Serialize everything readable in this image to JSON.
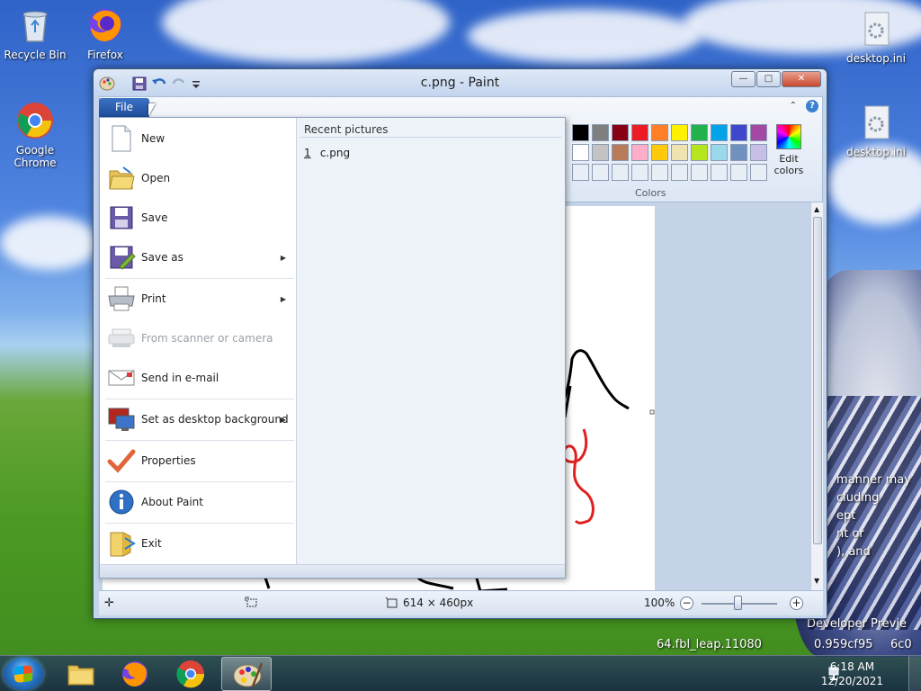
{
  "desktop": {
    "icons": [
      {
        "label": "Recycle Bin",
        "icon": "recycle-bin-icon"
      },
      {
        "label": "Firefox",
        "icon": "firefox-icon"
      },
      {
        "label": "Google Chrome",
        "icon": "chrome-icon"
      },
      {
        "label": "desktop.ini",
        "icon": "settings-file-icon"
      },
      {
        "label": "desktop.ini",
        "icon": "settings-file-icon"
      }
    ],
    "watermark_lines": [
      "manner may",
      "cluding",
      "ept",
      "nt or",
      "), and",
      "Developer Previe",
      "64.fbl_leap.11080",
      "0.959cf95",
      "6c0"
    ]
  },
  "window": {
    "title": "c.png - Paint",
    "controls": {
      "minimize": "—",
      "maximize": "□",
      "close": "✕"
    }
  },
  "ribbon": {
    "colors_label": "Colors",
    "edit_colors_label": "Edit colors",
    "palette_row1": [
      "#000000",
      "#7f7f7f",
      "#880015",
      "#ed1c24",
      "#ff7f27",
      "#fff200",
      "#22b14c",
      "#00a2e8",
      "#3f48cc",
      "#a349a4"
    ],
    "palette_row2": [
      "#ffffff",
      "#c3c3c3",
      "#b97a57",
      "#ffaec9",
      "#ffc90e",
      "#efe4b0",
      "#b5e61d",
      "#99d9ea",
      "#7092be",
      "#c8bfe7"
    ]
  },
  "file_menu": {
    "tab_label": "File",
    "items": [
      {
        "label": "New",
        "icon": "new-file-icon",
        "submenu": false,
        "disabled": false
      },
      {
        "label": "Open",
        "icon": "open-folder-icon",
        "submenu": false,
        "disabled": false
      },
      {
        "label": "Save",
        "icon": "save-icon",
        "submenu": false,
        "disabled": false
      },
      {
        "label": "Save as",
        "icon": "save-as-icon",
        "submenu": true,
        "disabled": false
      },
      {
        "label": "Print",
        "icon": "printer-icon",
        "submenu": true,
        "disabled": false
      },
      {
        "label": "From scanner or camera",
        "icon": "scanner-icon",
        "submenu": false,
        "disabled": true
      },
      {
        "label": "Send in e-mail",
        "icon": "email-icon",
        "submenu": false,
        "disabled": false
      },
      {
        "label": "Set as desktop background",
        "icon": "desktop-background-icon",
        "submenu": true,
        "disabled": false
      },
      {
        "label": "Properties",
        "icon": "checkmark-icon",
        "submenu": false,
        "disabled": false
      },
      {
        "label": "About Paint",
        "icon": "info-icon",
        "submenu": false,
        "disabled": false
      },
      {
        "label": "Exit",
        "icon": "exit-icon",
        "submenu": false,
        "disabled": false
      }
    ],
    "recent_title": "Recent pictures",
    "recent": [
      {
        "num": "1",
        "name": "c.png"
      }
    ]
  },
  "statusbar": {
    "dimensions": "614 × 460px",
    "zoom": "100%",
    "zoom_out": "−",
    "zoom_in": "+"
  },
  "taskbar": {
    "time": "6:18 AM",
    "date": "12/20/2021"
  }
}
